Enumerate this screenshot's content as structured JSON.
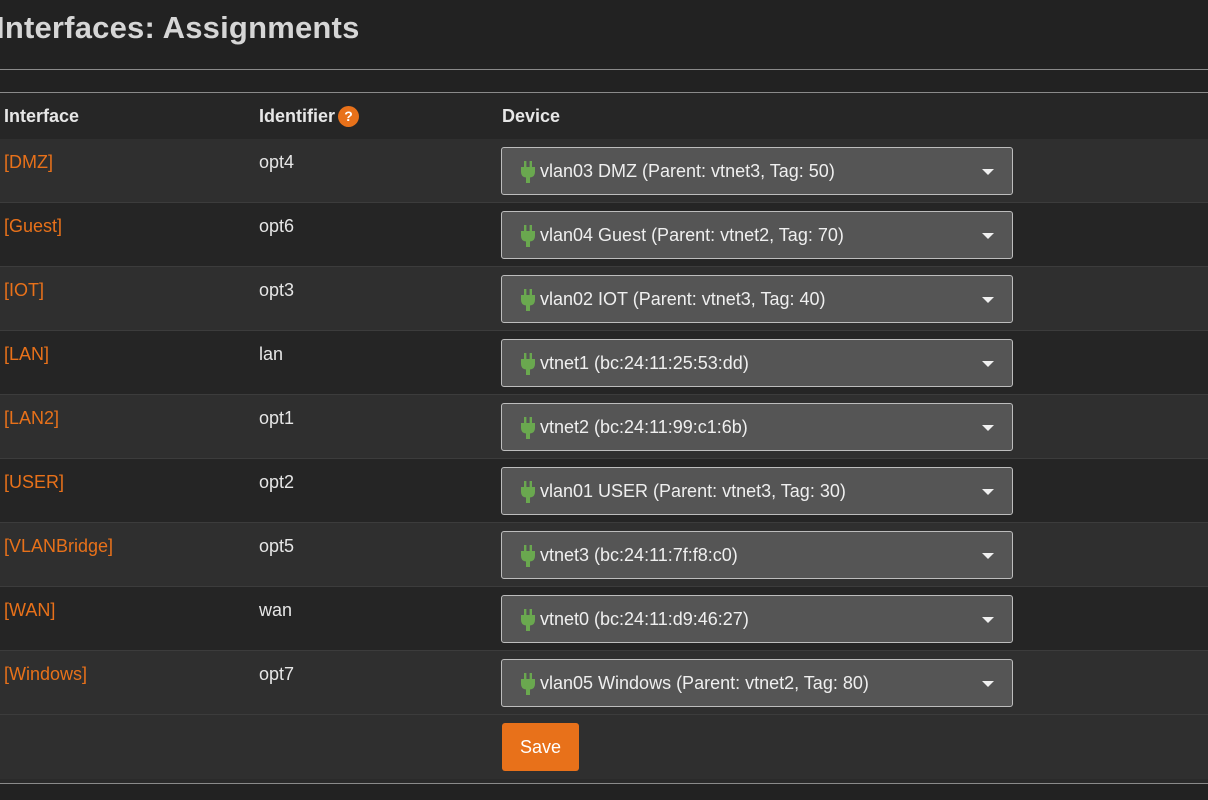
{
  "page": {
    "title": "Interfaces: Assignments"
  },
  "table": {
    "headers": {
      "interface": "Interface",
      "identifier": "Identifier",
      "identifier_help": "?",
      "device": "Device"
    },
    "rows": [
      {
        "interface": "[DMZ]",
        "identifier": "opt4",
        "device": "vlan03 DMZ (Parent: vtnet3, Tag: 50)"
      },
      {
        "interface": "[Guest]",
        "identifier": "opt6",
        "device": "vlan04 Guest (Parent: vtnet2, Tag: 70)"
      },
      {
        "interface": "[IOT]",
        "identifier": "opt3",
        "device": "vlan02 IOT (Parent: vtnet3, Tag: 40)"
      },
      {
        "interface": "[LAN]",
        "identifier": "lan",
        "device": "vtnet1 (bc:24:11:25:53:dd)"
      },
      {
        "interface": "[LAN2]",
        "identifier": "opt1",
        "device": "vtnet2 (bc:24:11:99:c1:6b)"
      },
      {
        "interface": "[USER]",
        "identifier": "opt2",
        "device": "vlan01 USER (Parent: vtnet3, Tag: 30)"
      },
      {
        "interface": "[VLANBridge]",
        "identifier": "opt5",
        "device": "vtnet3 (bc:24:11:7f:f8:c0)"
      },
      {
        "interface": "[WAN]",
        "identifier": "wan",
        "device": "vtnet0 (bc:24:11:d9:46:27)"
      },
      {
        "interface": "[Windows]",
        "identifier": "opt7",
        "device": "vlan05 Windows (Parent: vtnet2, Tag: 80)"
      }
    ]
  },
  "actions": {
    "save_label": "Save"
  },
  "icons": {
    "device_icon": "plug-icon",
    "dropdown_icon": "caret-down-icon",
    "help_icon": "question-icon"
  },
  "colors": {
    "accent": "#e8711a",
    "plug": "#6aa84f",
    "select_bg": "#555555",
    "background": "#222222"
  }
}
